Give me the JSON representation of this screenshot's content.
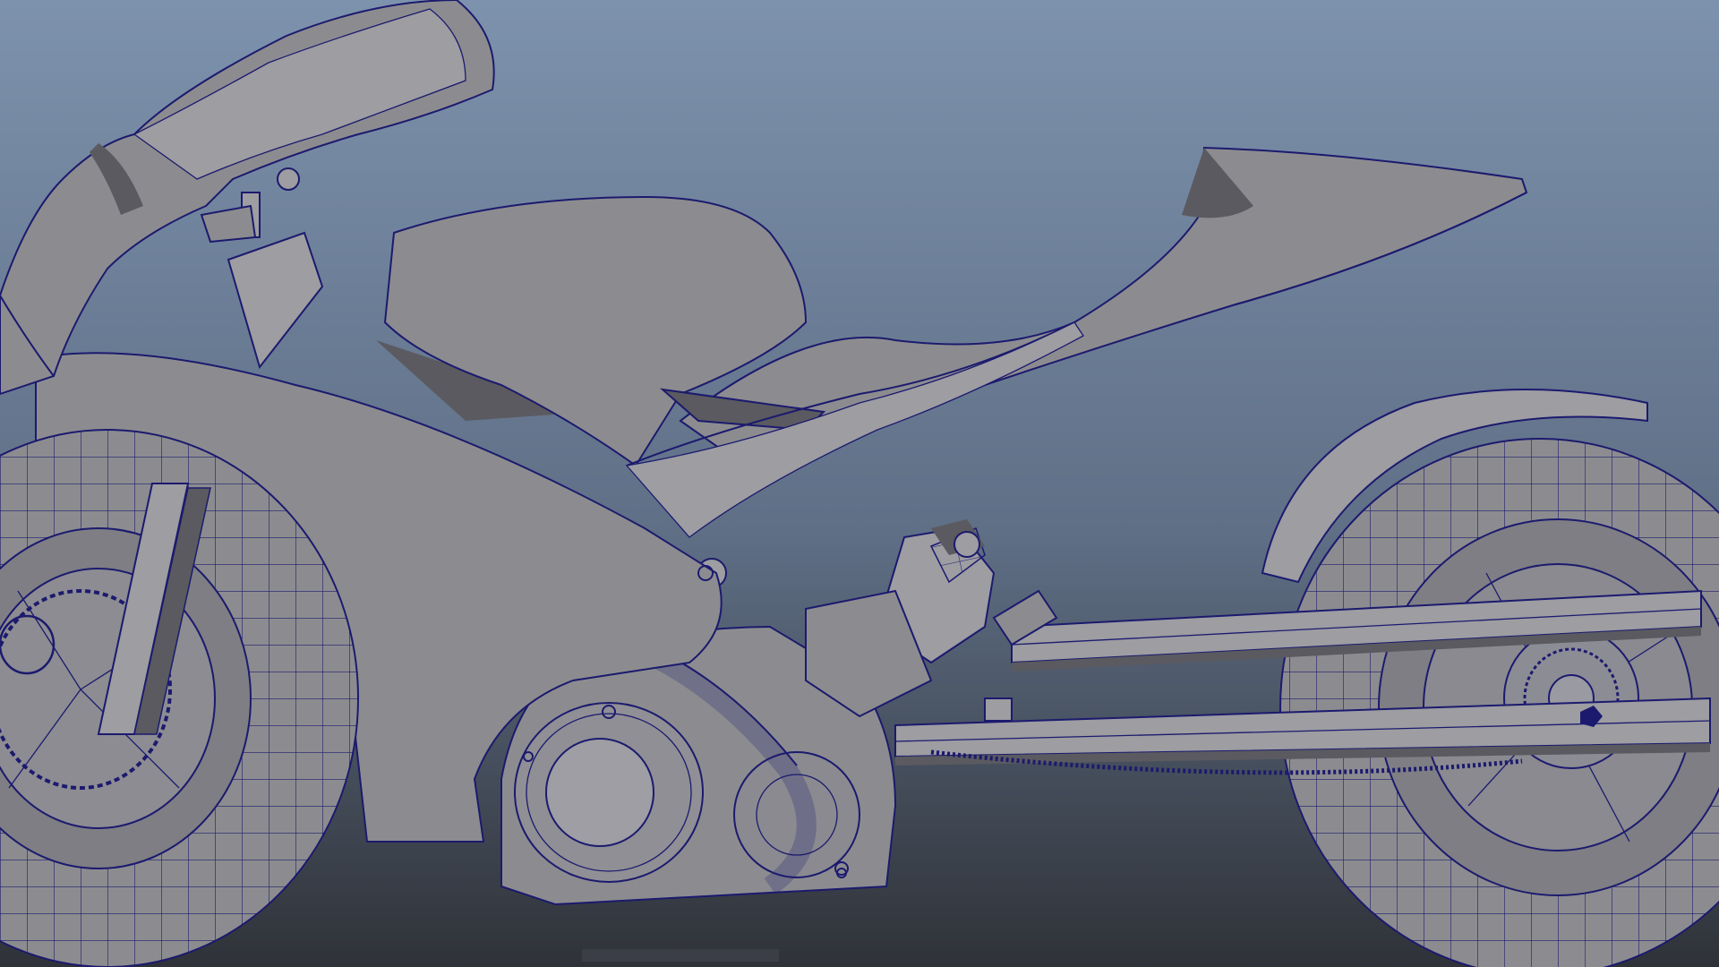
{
  "viewport": {
    "background_top": "#7d92ad",
    "background_bottom": "#2f3238",
    "mesh_color": "#8c8c90",
    "wire_color": "#1c1a6e"
  },
  "scene": {
    "object": "motorcycle-wireframe-mesh",
    "view": "side-orthographic"
  }
}
